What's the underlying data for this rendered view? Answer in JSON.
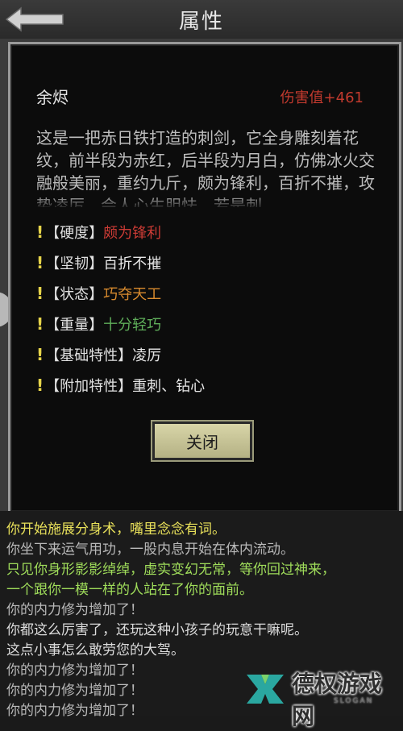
{
  "header": {
    "title": "属性",
    "back_icon": "back-arrow-icon"
  },
  "item": {
    "name": "余烬",
    "damage": "伤害值+461",
    "description": "这是一把赤日铁打造的刺剑，它全身雕刻着花纹，前半段为赤红，后半段为月白，仿佛冰火交融般美丽，重约九斤，颇为锋利，百折不摧，攻势凌厉，会人心生胆怯，若是刺"
  },
  "attributes": [
    {
      "mark": "!",
      "key": "【硬度】",
      "value": "颇为锋利",
      "color": "#cc3b35"
    },
    {
      "mark": "!",
      "key": "【坚韧】",
      "value": "百折不摧",
      "color": "#e6e6e6"
    },
    {
      "mark": "!",
      "key": "【状态】",
      "value": "巧夺天工",
      "color": "#d98b2e"
    },
    {
      "mark": "!",
      "key": "【重量】",
      "value": "十分轻巧",
      "color": "#5fae5a"
    },
    {
      "mark": "!",
      "key": "【基础特性】",
      "value": "凌厉",
      "color": "#e6e6e6"
    },
    {
      "mark": "!",
      "key": "【附加特性】",
      "value": "重刺、钻心",
      "color": "#e6e6e6"
    }
  ],
  "close_label": "关闭",
  "log": [
    {
      "text": "你开始施展分身术，嘴里念念有词。",
      "color": "#e8e05a"
    },
    {
      "text": "你坐下来运气用功，一股内息开始在体内流动。",
      "color": "#b9b9b9"
    },
    {
      "text": "只见你身形影影绰绰，虚实变幻无常，等你回过神来，",
      "color": "#9fdc5a"
    },
    {
      "text": "一个跟你一模一样的人站在了你的面前。",
      "color": "#9fdc5a"
    },
    {
      "text": "你的内力修为增加了！",
      "color": "#b9b9b9"
    },
    {
      "text": "你都这么厉害了，还玩这种小孩子的玩意干嘛呢。",
      "color": "#dcdcdc"
    },
    {
      "text": "这点小事怎么敢劳您的大驾。",
      "color": "#dcdcdc"
    },
    {
      "text": "你的内力修为增加了！",
      "color": "#b9b9b9"
    },
    {
      "text": "你的内力修为增加了！",
      "color": "#b9b9b9"
    },
    {
      "text": "你的内力修为增加了！",
      "color": "#b9b9b9"
    }
  ],
  "watermark": {
    "text": "德权游戏网",
    "sub": "SLOGAN"
  }
}
